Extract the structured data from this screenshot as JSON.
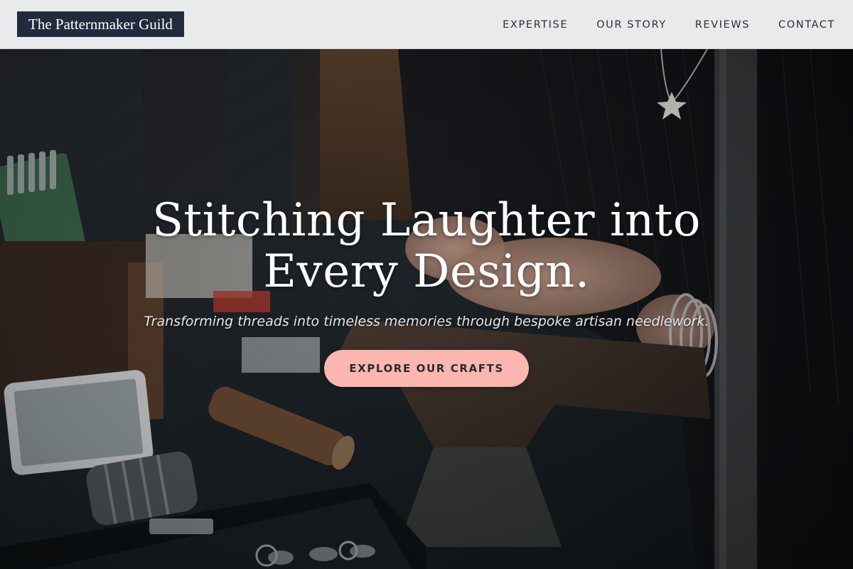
{
  "header": {
    "logo_text": "The Patternmaker Guild",
    "nav": [
      {
        "label": "EXPERTISE"
      },
      {
        "label": "OUR STORY"
      },
      {
        "label": "REVIEWS"
      },
      {
        "label": "CONTACT"
      }
    ]
  },
  "hero": {
    "title_line1": "Stitching Laughter into",
    "title_line2": "Every Design.",
    "subtitle": "Transforming threads into timeless memories through bespoke artisan needlework.",
    "cta_label": "EXPLORE OUR CRAFTS",
    "background_image": "artisan-workbench-photo"
  },
  "colors": {
    "header_bg": "#e9eaeb",
    "logo_bg": "#222b3d",
    "logo_text": "#ffffff",
    "nav_text": "#2a2f36",
    "cta_bg": "#fbb6b0",
    "cta_text": "#2b2b30",
    "hero_text": "#ffffff"
  }
}
